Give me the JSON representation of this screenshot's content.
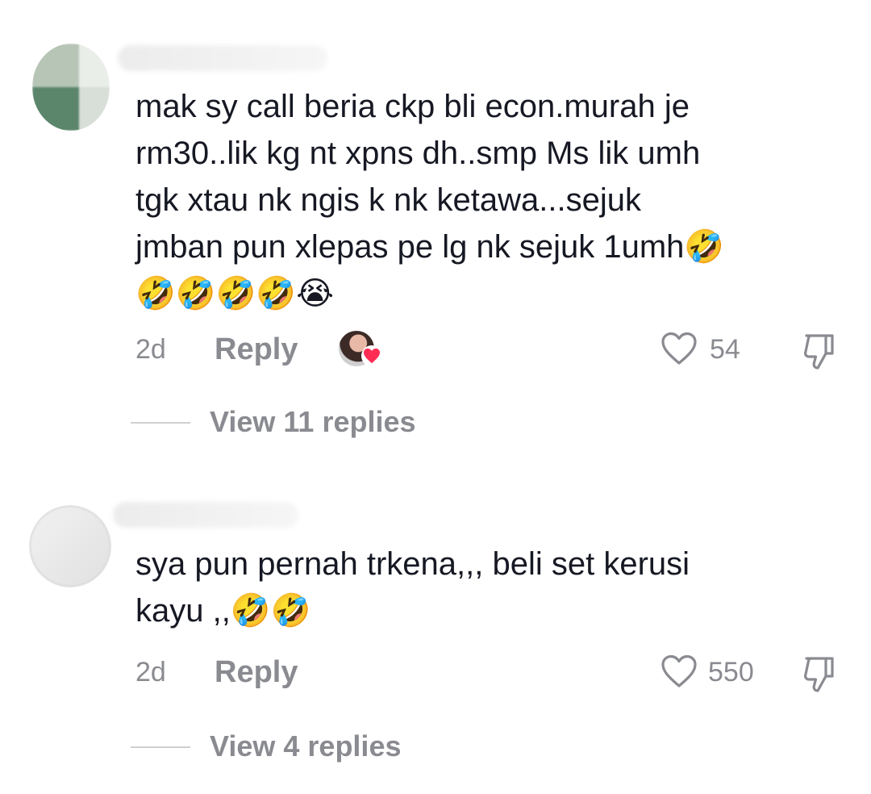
{
  "comments": [
    {
      "text": "mak sy call beria ckp bli econ.murah je\nrm30..lik kg nt xpns dh..smp Ms lik umh\ntgk xtau nk ngis k nk ketawa...sejuk\njmban pun xlepas pe lg nk sejuk 1umh🤣\n🤣🤣🤣🤣😭",
      "time": "2d",
      "reply_label": "Reply",
      "likes": "54",
      "view_replies": "View 11 replies"
    },
    {
      "text": "sya pun pernah trkena,,, beli set kerusi\nkayu ,,🤣🤣",
      "time": "2d",
      "reply_label": "Reply",
      "likes": "550",
      "view_replies": "View 4 replies"
    }
  ],
  "icons": {
    "like": "heart-outline-icon",
    "dislike": "thumbs-down-icon",
    "liked_by_creator": "red-heart-icon"
  },
  "colors": {
    "text": "#161823",
    "secondary": "#8a8b91",
    "creator_heart": "#fe2c55"
  }
}
